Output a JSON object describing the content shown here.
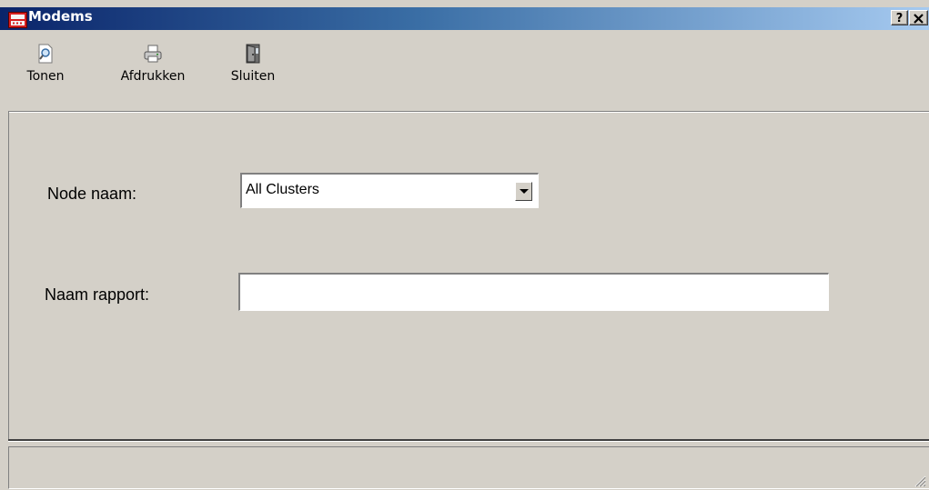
{
  "window": {
    "title": "Modems",
    "app_icon": "modem-app-icon",
    "help_label": "?",
    "close_label": "✕"
  },
  "toolbar": {
    "buttons": [
      {
        "label": "Tonen",
        "icon": "magnifier-preview-icon"
      },
      {
        "label": "Afdrukken",
        "icon": "printer-icon"
      },
      {
        "label": "Sluiten",
        "icon": "door-exit-icon"
      }
    ]
  },
  "form": {
    "node_label": "Node naam:",
    "node_value": "All Clusters",
    "report_label": "Naam rapport:",
    "report_value": ""
  },
  "status": {
    "text": ""
  },
  "colors": {
    "title_start": "#0a246a",
    "title_end": "#a6caf0",
    "face": "#d4d0c8"
  }
}
